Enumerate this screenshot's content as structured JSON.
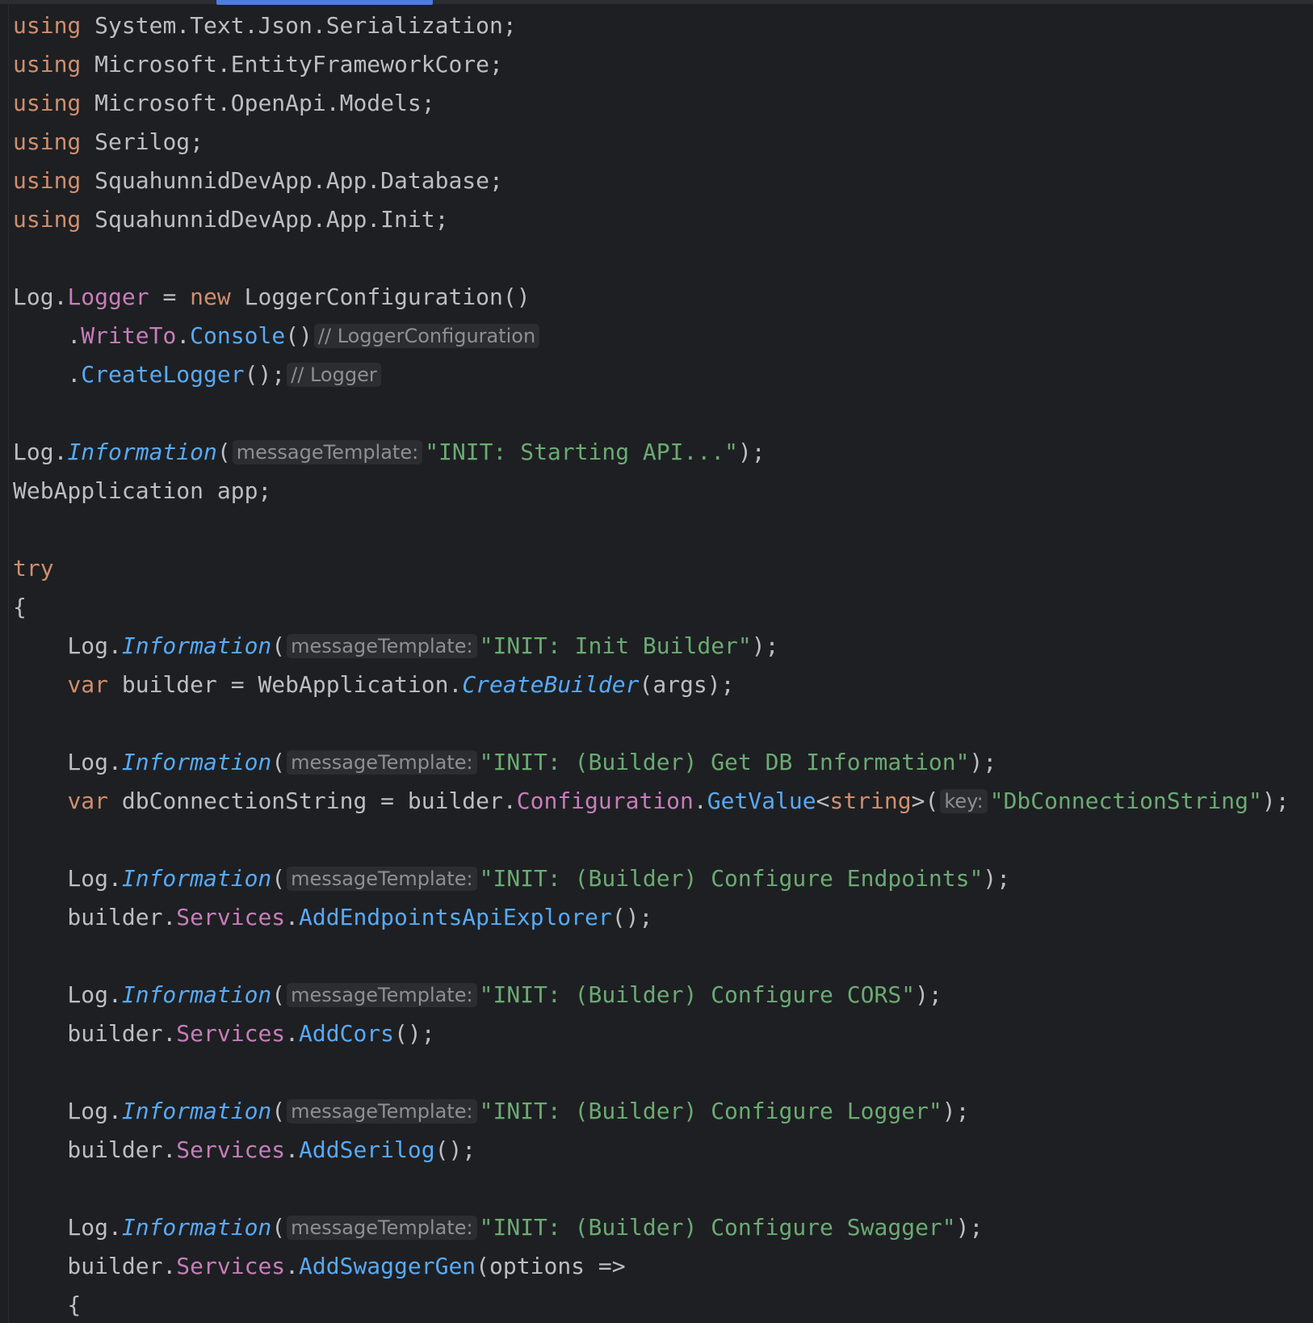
{
  "lines": [
    [
      {
        "t": "using",
        "c": "kw"
      },
      {
        "t": " System.Text.Json.Serialization;"
      }
    ],
    [
      {
        "t": "using",
        "c": "kw"
      },
      {
        "t": " Microsoft.EntityFrameworkCore;"
      }
    ],
    [
      {
        "t": "using",
        "c": "kw"
      },
      {
        "t": " Microsoft.OpenApi.Models;"
      }
    ],
    [
      {
        "t": "using",
        "c": "kw"
      },
      {
        "t": " Serilog;"
      }
    ],
    [
      {
        "t": "using",
        "c": "kw"
      },
      {
        "t": " SquahunnidDevApp.App.Database;"
      }
    ],
    [
      {
        "t": "using",
        "c": "kw"
      },
      {
        "t": " SquahunnidDevApp.App.Init;"
      }
    ],
    [],
    [
      {
        "t": "Log."
      },
      {
        "t": "Logger",
        "c": "prop"
      },
      {
        "t": " = "
      },
      {
        "t": "new",
        "c": "kw"
      },
      {
        "t": " LoggerConfiguration()"
      }
    ],
    [
      {
        "t": "    ."
      },
      {
        "t": "WriteTo",
        "c": "prop"
      },
      {
        "t": "."
      },
      {
        "t": "Console",
        "c": "mth"
      },
      {
        "t": "()"
      },
      {
        "t": "// LoggerConfiguration",
        "c": "hint"
      }
    ],
    [
      {
        "t": "    ."
      },
      {
        "t": "CreateLogger",
        "c": "mth"
      },
      {
        "t": "();"
      },
      {
        "t": "// Logger",
        "c": "hint"
      }
    ],
    [],
    [
      {
        "t": "Log."
      },
      {
        "t": "Information",
        "c": "mth-it"
      },
      {
        "t": "("
      },
      {
        "t": "messageTemplate:",
        "c": "hint"
      },
      {
        "t": "\"INIT: Starting API...\"",
        "c": "str"
      },
      {
        "t": ");"
      }
    ],
    [
      {
        "t": "WebApplication app;"
      }
    ],
    [],
    [
      {
        "t": "try",
        "c": "kw"
      }
    ],
    [
      {
        "t": "{"
      }
    ],
    [
      {
        "t": "    Log."
      },
      {
        "t": "Information",
        "c": "mth-it"
      },
      {
        "t": "("
      },
      {
        "t": "messageTemplate:",
        "c": "hint"
      },
      {
        "t": "\"INIT: Init Builder\"",
        "c": "str"
      },
      {
        "t": ");"
      }
    ],
    [
      {
        "t": "    "
      },
      {
        "t": "var",
        "c": "kw"
      },
      {
        "t": " builder = WebApplication."
      },
      {
        "t": "CreateBuilder",
        "c": "mth-it"
      },
      {
        "t": "(args);"
      }
    ],
    [],
    [
      {
        "t": "    Log."
      },
      {
        "t": "Information",
        "c": "mth-it"
      },
      {
        "t": "("
      },
      {
        "t": "messageTemplate:",
        "c": "hint"
      },
      {
        "t": "\"INIT: (Builder) Get DB Information\"",
        "c": "str"
      },
      {
        "t": ");"
      }
    ],
    [
      {
        "t": "    "
      },
      {
        "t": "var",
        "c": "kw"
      },
      {
        "t": " dbConnectionString = builder."
      },
      {
        "t": "Configuration",
        "c": "prop"
      },
      {
        "t": "."
      },
      {
        "t": "GetValue",
        "c": "mth"
      },
      {
        "t": "<"
      },
      {
        "t": "string",
        "c": "kw"
      },
      {
        "t": ">("
      },
      {
        "t": "key:",
        "c": "hint"
      },
      {
        "t": "\"DbConnectionString\"",
        "c": "str"
      },
      {
        "t": ");"
      }
    ],
    [],
    [
      {
        "t": "    Log."
      },
      {
        "t": "Information",
        "c": "mth-it"
      },
      {
        "t": "("
      },
      {
        "t": "messageTemplate:",
        "c": "hint"
      },
      {
        "t": "\"INIT: (Builder) Configure Endpoints\"",
        "c": "str"
      },
      {
        "t": ");"
      }
    ],
    [
      {
        "t": "    builder."
      },
      {
        "t": "Services",
        "c": "prop"
      },
      {
        "t": "."
      },
      {
        "t": "AddEndpointsApiExplorer",
        "c": "mth"
      },
      {
        "t": "();"
      }
    ],
    [],
    [
      {
        "t": "    Log."
      },
      {
        "t": "Information",
        "c": "mth-it"
      },
      {
        "t": "("
      },
      {
        "t": "messageTemplate:",
        "c": "hint"
      },
      {
        "t": "\"INIT: (Builder) Configure CORS\"",
        "c": "str"
      },
      {
        "t": ");"
      }
    ],
    [
      {
        "t": "    builder."
      },
      {
        "t": "Services",
        "c": "prop"
      },
      {
        "t": "."
      },
      {
        "t": "AddCors",
        "c": "mth"
      },
      {
        "t": "();"
      }
    ],
    [],
    [
      {
        "t": "    Log."
      },
      {
        "t": "Information",
        "c": "mth-it"
      },
      {
        "t": "("
      },
      {
        "t": "messageTemplate:",
        "c": "hint"
      },
      {
        "t": "\"INIT: (Builder) Configure Logger\"",
        "c": "str"
      },
      {
        "t": ");"
      }
    ],
    [
      {
        "t": "    builder."
      },
      {
        "t": "Services",
        "c": "prop"
      },
      {
        "t": "."
      },
      {
        "t": "AddSerilog",
        "c": "mth"
      },
      {
        "t": "();"
      }
    ],
    [],
    [
      {
        "t": "    Log."
      },
      {
        "t": "Information",
        "c": "mth-it"
      },
      {
        "t": "("
      },
      {
        "t": "messageTemplate:",
        "c": "hint"
      },
      {
        "t": "\"INIT: (Builder) Configure Swagger\"",
        "c": "str"
      },
      {
        "t": ");"
      }
    ],
    [
      {
        "t": "    builder."
      },
      {
        "t": "Services",
        "c": "prop"
      },
      {
        "t": "."
      },
      {
        "t": "AddSwaggerGen",
        "c": "mth"
      },
      {
        "t": "(options =>"
      }
    ],
    [
      {
        "t": "    {"
      }
    ]
  ]
}
